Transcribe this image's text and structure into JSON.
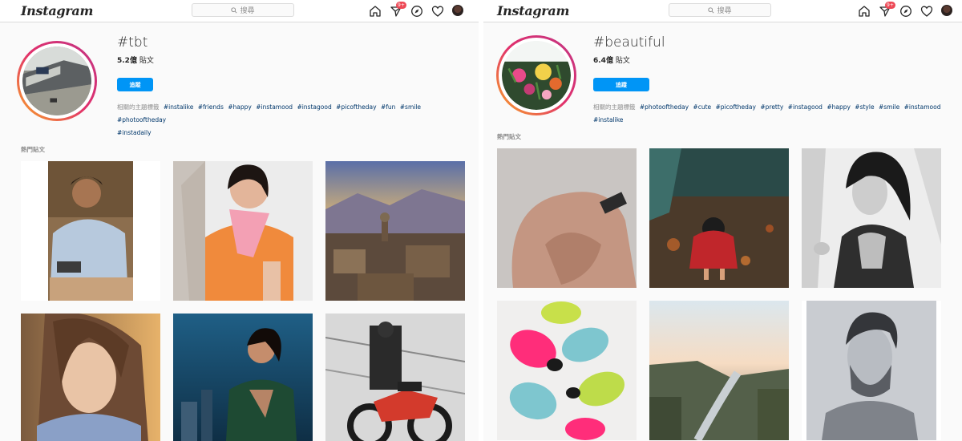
{
  "colors": {
    "accent": "#0095f6",
    "badge": "#ed4956",
    "hashtag": "#00376b",
    "muted": "#8e8e8e"
  },
  "panels": [
    {
      "app_name": "Instagram",
      "search_placeholder": "搜尋",
      "notification_badge": "9+",
      "hashtag": "#tbt",
      "post_count": "5.2億",
      "post_count_suffix": " 貼文",
      "follow_label": "追蹤",
      "related_label": "相關的主題標籤",
      "related_tags": [
        "#instalike",
        "#friends",
        "#happy",
        "#instamood",
        "#instagood",
        "#picoftheday",
        "#fun",
        "#smile",
        "#photooftheday",
        "#instadaily"
      ],
      "top_posts_label": "熱門貼文",
      "icons": [
        "home-icon",
        "direct-message-icon",
        "explore-compass-icon",
        "activity-heart-icon",
        "profile-avatar"
      ]
    },
    {
      "app_name": "Instagram",
      "search_placeholder": "搜尋",
      "notification_badge": "9+",
      "hashtag": "#beautiful",
      "post_count": "6.4億",
      "post_count_suffix": " 貼文",
      "follow_label": "追蹤",
      "related_label": "相關的主題標籤",
      "related_tags": [
        "#photooftheday",
        "#cute",
        "#picoftheday",
        "#pretty",
        "#instagood",
        "#happy",
        "#style",
        "#smile",
        "#instamood",
        "#instalike"
      ],
      "top_posts_label": "熱門貼文",
      "icons": [
        "home-icon",
        "direct-message-icon",
        "explore-compass-icon",
        "activity-heart-icon",
        "profile-avatar"
      ]
    }
  ]
}
